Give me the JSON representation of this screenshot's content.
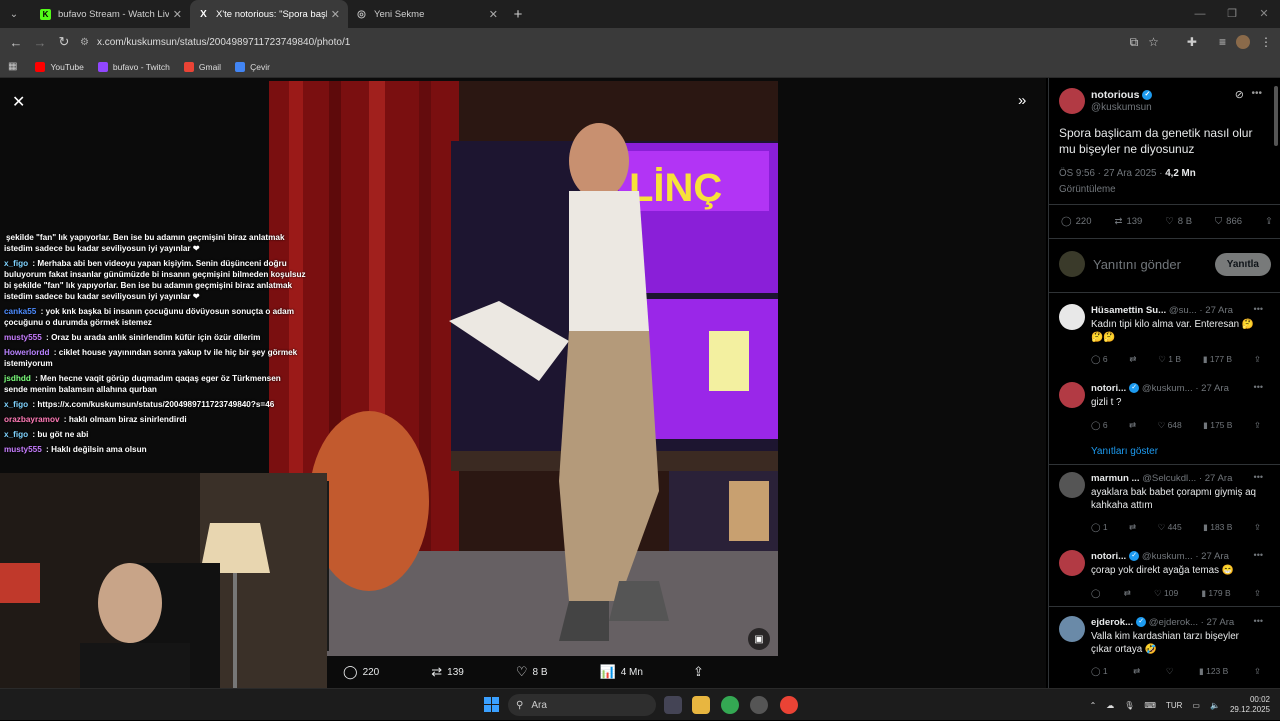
{
  "browser": {
    "tabs": [
      {
        "title": "bufavo Stream - Watch Live on",
        "favicon_color": "#53fc18",
        "favicon_letter": "K",
        "active": false
      },
      {
        "title": "X'te notorious: \"Spora başlicam",
        "favicon_color": "#000000",
        "favicon_letter": "X",
        "active": true
      },
      {
        "title": "Yeni Sekme",
        "favicon_color": "#888888",
        "favicon_letter": "◎",
        "active": false
      }
    ],
    "new_tab": "+",
    "url": "x.com/kuskumsun/status/2004989711723749840/photo/1",
    "bookmarks": [
      {
        "label": "YouTube",
        "color": "#ff0000"
      },
      {
        "label": "bufavo - Twitch",
        "color": "#9146ff"
      },
      {
        "label": "Gmail",
        "color": "#ea4335"
      },
      {
        "label": "Çevir",
        "color": "#4285f4"
      }
    ]
  },
  "chat": {
    "messages": [
      {
        "user": "",
        "color": "#ffffff",
        "text": "şekilde \"fan\" lık yapıyorlar. Ben ise bu adamın geçmişini biraz anlatmak istedim sadece bu kadar seviliyosun iyi yayınlar ❤"
      },
      {
        "user": "x_figo",
        "color": "#7fd3ff",
        "text": "Merhaba abi ben videoyu yapan kişiyim. Senin düşünceni doğru buluyorum fakat insanlar günümüzde bi insanın geçmişini bilmeden koşulsuz bi şekilde \"fan\" lık yapıyorlar. Ben ise bu adamın geçmişini biraz anlatmak istedim sadece bu kadar seviliyosun iyi yayınlar ❤"
      },
      {
        "user": "canka55",
        "color": "#4d8cff",
        "text": "yok knk başka bi insanın çocuğunu dövüyosun sonuçta o adam çocuğunu o durumda görmek istemez"
      },
      {
        "user": "musty555",
        "color": "#c77dff",
        "text": "Oraz bu arada anlık sinirlendim küfür için özür dilerim"
      },
      {
        "user": "Howerlordd",
        "color": "#b983ff",
        "text": "ciklet house yayınından sonra yakup tv ile hiç bir şey görmek istemiyorum"
      },
      {
        "user": "jsdhdd",
        "color": "#7cff7c",
        "text": "Men hecne vaqit görüp duqmadım qaqaş eger öz Türkmensen sende menim balamsın allahına qurban"
      },
      {
        "user": "x_figo",
        "color": "#7fd3ff",
        "text": "https://x.com/kuskumsun/status/2004989711723749840?s=46"
      },
      {
        "user": "orazbayramov",
        "color": "#ff7ab6",
        "text": "haklı olmam biraz sinirlendirdi"
      },
      {
        "user": "x_figo",
        "color": "#7fd3ff",
        "text": "bu göt ne abi"
      },
      {
        "user": "musty555",
        "color": "#c77dff",
        "text": "Haklı değilsin ama olsun"
      }
    ]
  },
  "photo_actions": {
    "replies": "220",
    "reposts": "139",
    "likes": "8 B",
    "views": "4 Mn"
  },
  "tweet": {
    "name": "notorious",
    "handle": "@kuskumsun",
    "text": "Spora başlicam da genetik nasıl olur mu bişeyler ne diyosunuz",
    "time": "ÖS 9:56 · 27 Ara 2025 · ",
    "views_count": "4,2 Mn",
    "views_label": "Görüntüleme",
    "stats": {
      "replies": "220",
      "reposts": "139",
      "likes": "8 B",
      "bookmarks": "866"
    },
    "reply_placeholder": "Yanıtını gönder",
    "reply_button": "Yanıtla"
  },
  "replies": [
    {
      "name": "Hüsamettin Su...",
      "handle": "@su...",
      "date": "· 27 Ara",
      "text": "Kadın tipi kilo alma var. Enteresan 🤔🤔🤔",
      "stats": [
        "6",
        "",
        "1 B",
        "177 B"
      ],
      "avatar": "#ffffff"
    },
    {
      "name": "notori...",
      "handle": "@kuskum...",
      "date": "· 27 Ara",
      "text": "gizli t ?",
      "stats": [
        "6",
        "",
        "648",
        "175 B"
      ],
      "avatar": "#b23a44"
    },
    {
      "name": "marmun ...",
      "handle": "@Selcukdl...",
      "date": "· 27 Ara",
      "text": "ayaklara bak babet çorapmı giymiş aq kahkaha attım",
      "stats": [
        "1",
        "",
        "445",
        "183 B"
      ],
      "avatar": "#555555"
    },
    {
      "name": "notori...",
      "handle": "@kuskum...",
      "date": "· 27 Ara",
      "text": "çorap yok direkt ayağa temas 😁",
      "stats": [
        "",
        "",
        "109",
        "179 B"
      ],
      "avatar": "#b23a44"
    },
    {
      "name": "ejderok...",
      "handle": "@ejderok...",
      "date": "· 27 Ara",
      "text": "Valla kim kardashian tarzı bişeyler çıkar ortaya 🤣",
      "stats": [
        "1",
        "",
        "",
        "123 B"
      ],
      "avatar": "#6a8aa8"
    }
  ],
  "show_replies": "Yanıtları göster",
  "taskbar": {
    "search": "Ara",
    "lang": "TUR",
    "time": "00:02",
    "date": "29.12.2025"
  }
}
